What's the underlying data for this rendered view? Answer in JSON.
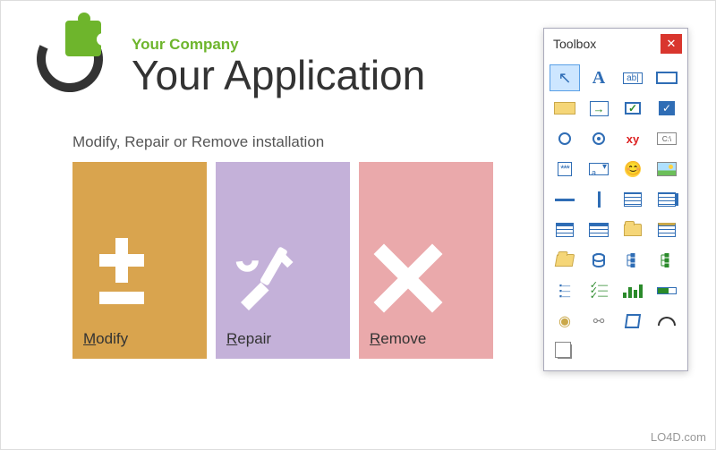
{
  "header": {
    "company": "Your Company",
    "app_name": "Your Application"
  },
  "instruction": "Modify, Repair or Remove installation",
  "tiles": {
    "modify": {
      "label": "Modify",
      "hotkey": "M",
      "color": "#d9a44e",
      "icon": "plusminus-icon"
    },
    "repair": {
      "label": "Repair",
      "hotkey": "R",
      "color": "#c4b1d9",
      "icon": "tools-icon"
    },
    "remove": {
      "label": "Remove",
      "hotkey": "R",
      "color": "#eaa9ab",
      "icon": "x-icon"
    }
  },
  "toolbox": {
    "title": "Toolbox",
    "close_label": "✕",
    "selected_index": 0,
    "tools": [
      {
        "name": "pointer-tool",
        "icon": "cursor-icon",
        "glyph": "↖",
        "selected": true
      },
      {
        "name": "label-tool",
        "icon": "text-A-icon",
        "glyph": "A"
      },
      {
        "name": "textbox-tool",
        "icon": "textbox-icon",
        "glyph": "ab|"
      },
      {
        "name": "panel-tool",
        "icon": "rect-outline-icon"
      },
      {
        "name": "groupbox-tool",
        "icon": "rect-fill-icon"
      },
      {
        "name": "button-tool",
        "icon": "arrow-right-icon",
        "glyph": "→"
      },
      {
        "name": "checkbox-tool",
        "icon": "checkbox-icon",
        "glyph": "✓"
      },
      {
        "name": "checkbox-checked-tool",
        "icon": "checkbox-filled-icon",
        "glyph": "✓"
      },
      {
        "name": "radio-empty-tool",
        "icon": "radio-empty-icon"
      },
      {
        "name": "radio-selected-tool",
        "icon": "radio-selected-icon"
      },
      {
        "name": "hyperlink-tool",
        "icon": "xy-text-icon",
        "glyph": "xy"
      },
      {
        "name": "commandline-tool",
        "icon": "cmd-icon",
        "glyph": "C:\\"
      },
      {
        "name": "password-tool",
        "icon": "password-stars-icon",
        "glyph": "***"
      },
      {
        "name": "combobox-tool",
        "icon": "combobox-icon",
        "glyph": "a"
      },
      {
        "name": "image-tool",
        "icon": "smiley-icon"
      },
      {
        "name": "picturebox-tool",
        "icon": "picture-icon"
      },
      {
        "name": "hline-tool",
        "icon": "hline-icon"
      },
      {
        "name": "vline-tool",
        "icon": "vline-icon"
      },
      {
        "name": "listbox-tool",
        "icon": "listbox-icon"
      },
      {
        "name": "listbox-scroll-tool",
        "icon": "listbox-scroll-icon"
      },
      {
        "name": "listview-tool",
        "icon": "listview-icon"
      },
      {
        "name": "listview-detail-tool",
        "icon": "listview-detail-icon"
      },
      {
        "name": "folder-tool",
        "icon": "folder-icon"
      },
      {
        "name": "folder-list-tool",
        "icon": "folder-list-icon"
      },
      {
        "name": "folder-open-tool",
        "icon": "folder-open-icon"
      },
      {
        "name": "database-tool",
        "icon": "database-icon"
      },
      {
        "name": "tree-tool",
        "icon": "tree-icon"
      },
      {
        "name": "tree-checked-tool",
        "icon": "tree-checked-icon"
      },
      {
        "name": "checklist-tool",
        "icon": "checklist-icon"
      },
      {
        "name": "checklist-green-tool",
        "icon": "checklist-green-icon",
        "glyph": "✓"
      },
      {
        "name": "chart-tool",
        "icon": "bar-chart-icon"
      },
      {
        "name": "progress-tool",
        "icon": "progress-icon"
      },
      {
        "name": "pin-tool",
        "icon": "pin-icon",
        "glyph": "📌"
      },
      {
        "name": "link-tool",
        "icon": "chain-link-icon",
        "glyph": "🔗"
      },
      {
        "name": "box3d-tool",
        "icon": "box3d-icon"
      },
      {
        "name": "arc-tool",
        "icon": "arc-icon"
      },
      {
        "name": "copy-tool",
        "icon": "copy-icon"
      }
    ]
  },
  "watermark": "LO4D.com"
}
